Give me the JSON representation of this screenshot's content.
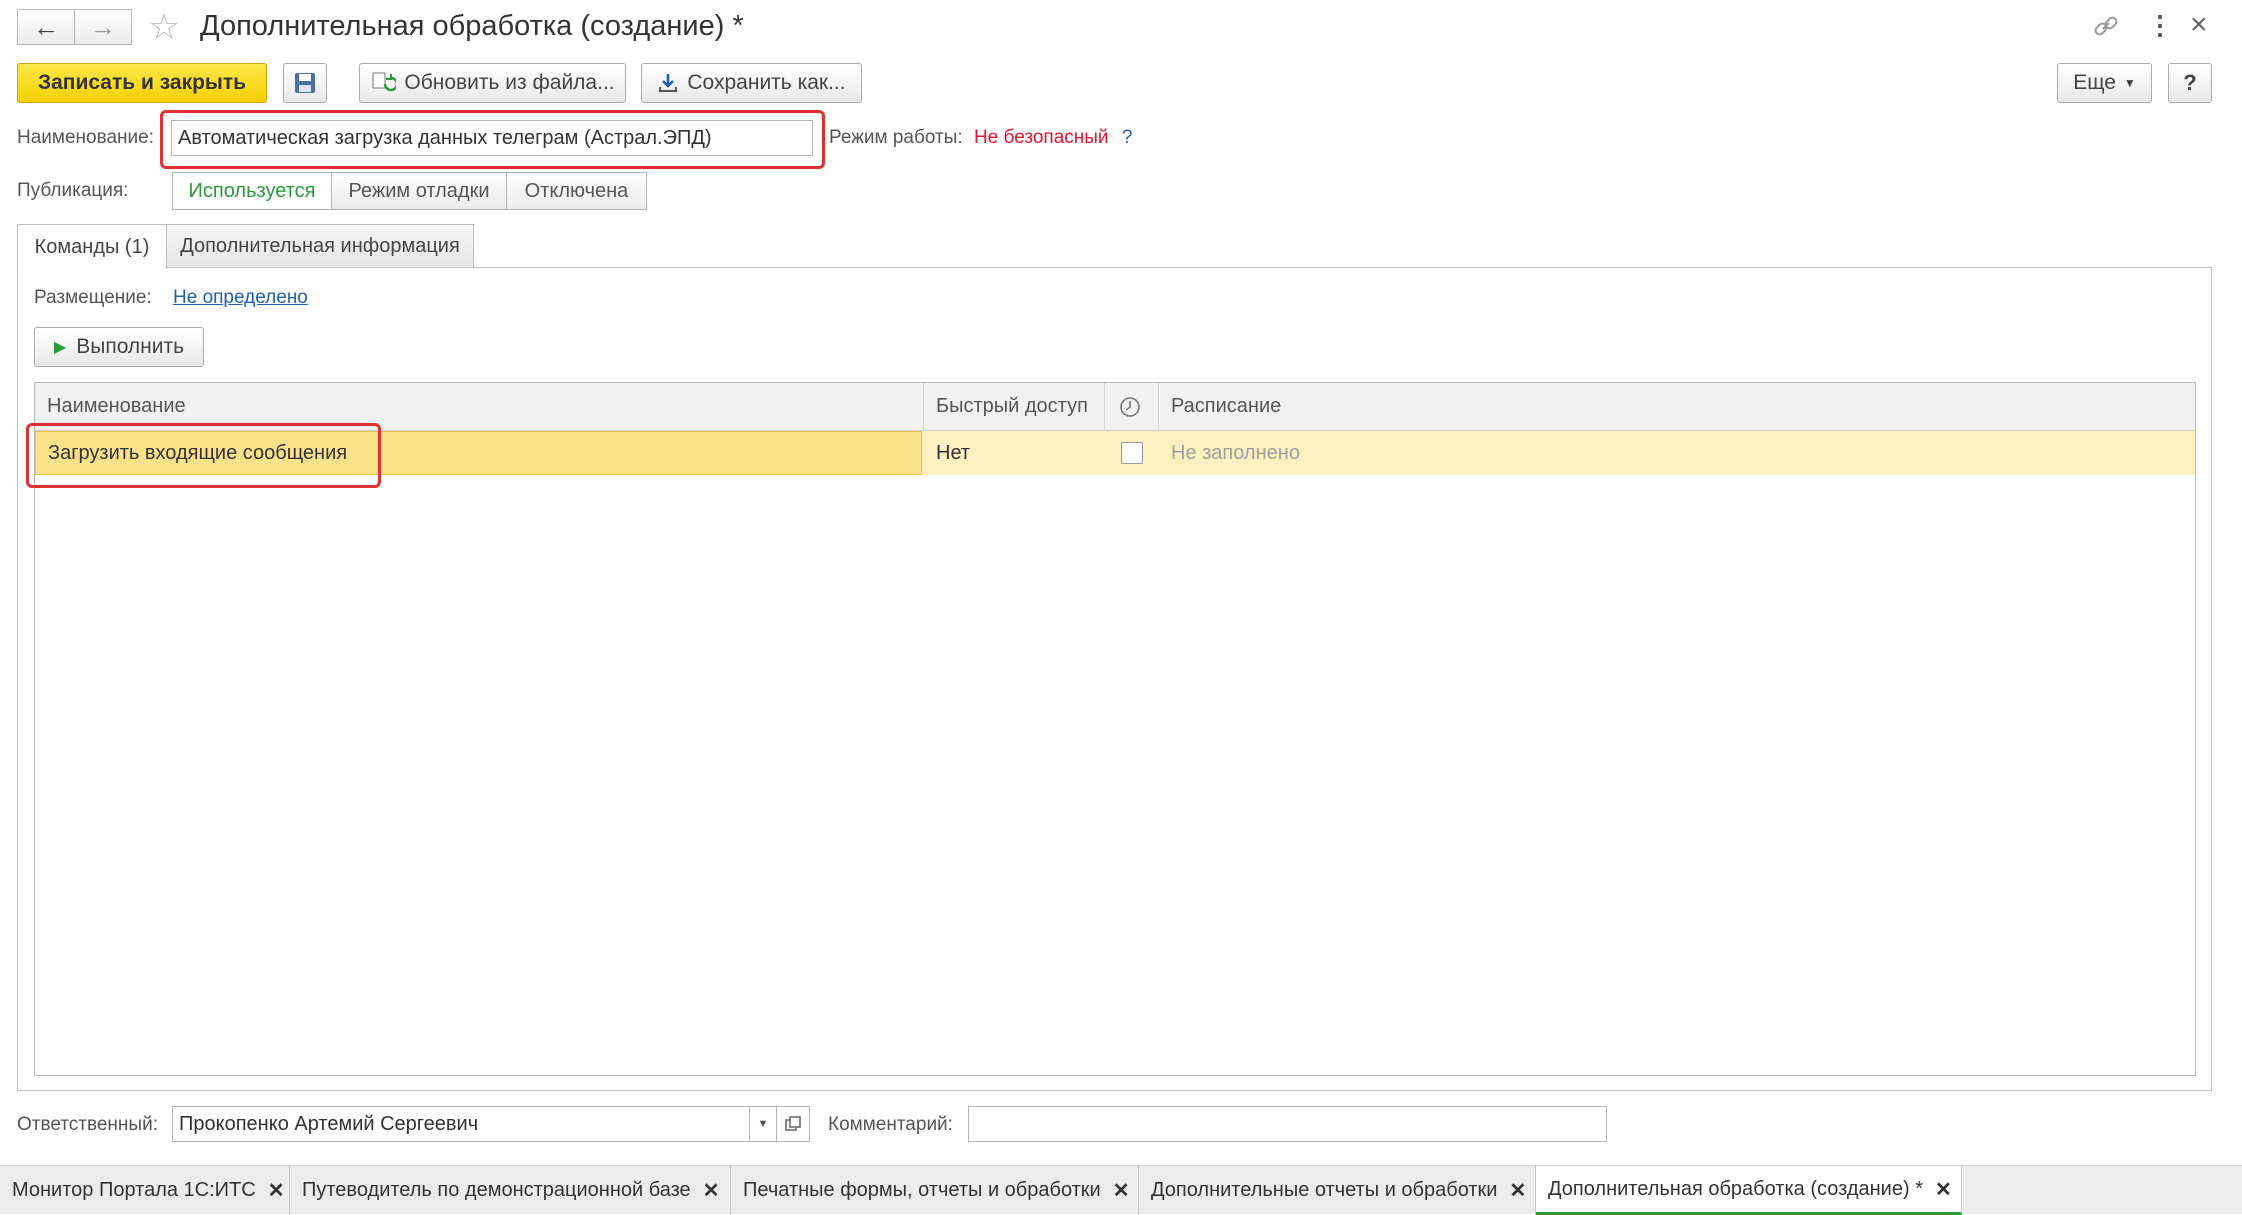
{
  "window": {
    "title": "Дополнительная обработка (создание) *",
    "back_icon": "←",
    "forward_icon": "→",
    "star_icon": "☆",
    "link_icon": "🔗",
    "more_icon": "⋮",
    "close_icon": "×"
  },
  "toolbar": {
    "save_close_label": "Записать и закрыть",
    "update_from_file_label": "Обновить из файла...",
    "save_as_label": "Сохранить как...",
    "more_label": "Еще",
    "help_label": "?"
  },
  "form": {
    "name_label": "Наименование:",
    "name_value": "Автоматическая загрузка данных телеграм (Астрал.ЭПД)",
    "mode_label": "Режим работы:",
    "mode_value": "Не безопасный",
    "mode_help": "?",
    "publication_label": "Публикация:",
    "publication_options": [
      "Используется",
      "Режим отладки",
      "Отключена"
    ]
  },
  "tabs": [
    "Команды (1)",
    "Дополнительная информация"
  ],
  "commands": {
    "placement_label": "Размещение:",
    "placement_value": "Не определено",
    "run_label": "Выполнить",
    "columns": [
      "Наименование",
      "Быстрый доступ",
      "",
      "Расписание"
    ],
    "rows": [
      {
        "name": "Загрузить входящие сообщения",
        "quick_access": "Нет",
        "checked": false,
        "schedule": "Не заполнено"
      }
    ]
  },
  "footer": {
    "responsible_label": "Ответственный:",
    "responsible_value": "Прокопенко Артемий Сергеевич",
    "comment_label": "Комментарий:",
    "comment_value": ""
  },
  "bottom_tabs": [
    "Монитор Портала 1С:ИТС",
    "Путеводитель по демонстрационной базе",
    "Печатные формы, отчеты и обработки",
    "Дополнительные отчеты и обработки",
    "Дополнительная обработка (создание) *"
  ],
  "colors": {
    "accent_yellow": "#f6d000",
    "red_text": "#e8112d",
    "green_text": "#2a9a3c",
    "link_blue": "#1d5fb0",
    "row_highlight": "#fdf1c2",
    "active_tab_underline": "#2a9a3c"
  }
}
